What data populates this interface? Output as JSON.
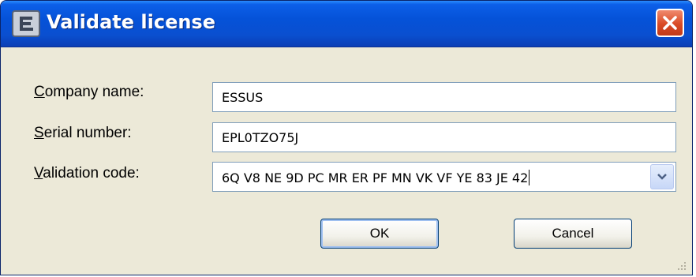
{
  "window": {
    "title": "Validate license",
    "icon": "app-e-icon",
    "close_icon": "close-icon"
  },
  "form": {
    "company": {
      "label_u": "C",
      "label_rest": "ompany name:",
      "value": "ESSUS"
    },
    "serial": {
      "label_u": "S",
      "label_rest": "erial number:",
      "value": "EPL0TZO75J"
    },
    "validation": {
      "label_u": "V",
      "label_rest": "alidation code:",
      "value": "6Q V8 NE 9D PC MR ER PF MN VK VF YE 83 JE 42"
    }
  },
  "buttons": {
    "ok": "OK",
    "cancel": "Cancel"
  },
  "colors": {
    "titlebar": "#0552d8",
    "window_bg": "#ece9d8",
    "close": "#d94a25",
    "field_border": "#7f9db9"
  }
}
